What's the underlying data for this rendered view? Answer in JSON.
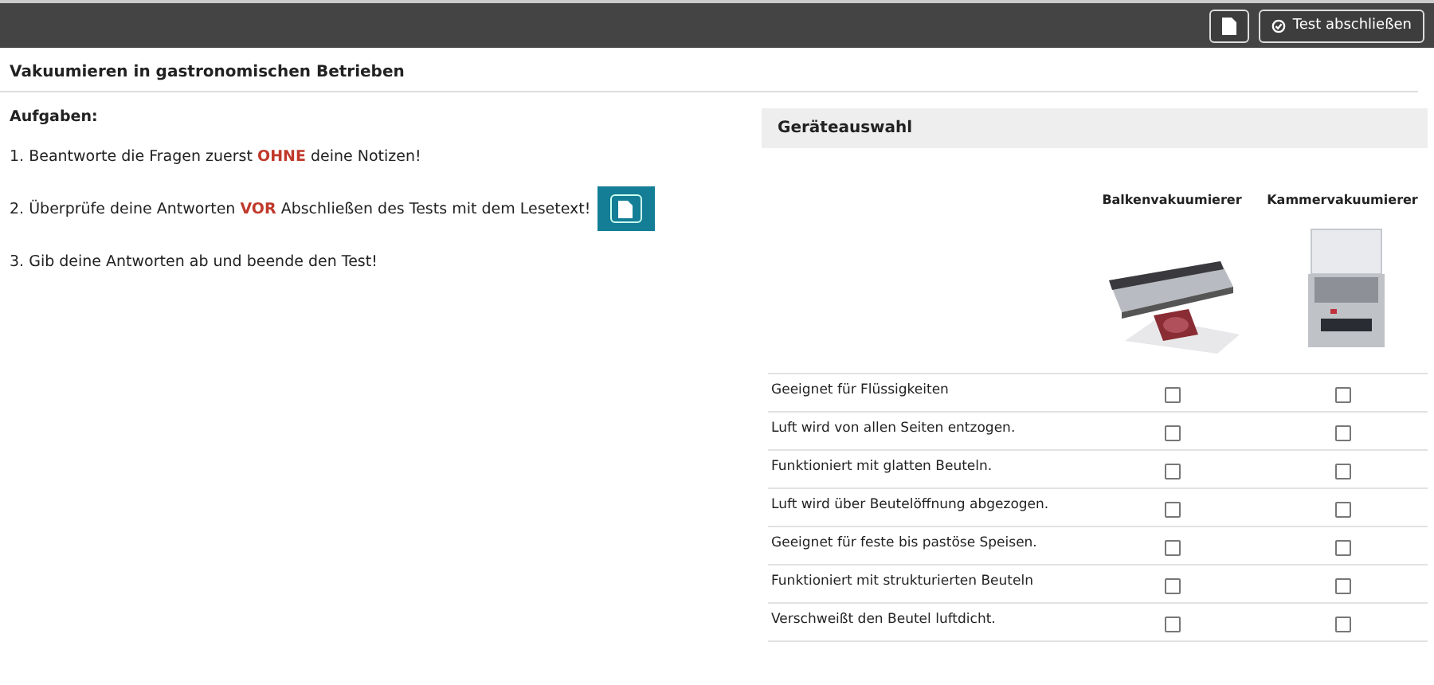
{
  "toolbar": {
    "buttons": [
      {
        "kind": "icon"
      },
      {
        "kind": "text",
        "label": "Test abschließen"
      }
    ]
  },
  "page_title": "Vakuumieren in gastronomischen Betrieben",
  "tasks": {
    "heading": "Aufgaben:",
    "items": [
      {
        "kind": "text",
        "text": "1. Beantworte die Fragen zuerst **OHNE** deine Notizen!"
      },
      {
        "kind": "with_button",
        "text": "2. Überprüfe deine Antworten **VOR** Abschließen des Tests mit dem Lesetext!"
      },
      {
        "kind": "text",
        "text": "3. Gib deine Antworten ab und beende den Test!"
      }
    ]
  },
  "selection": {
    "title": "Geräteauswahl",
    "columns": [
      {
        "name": "Balkenvakuumierer",
        "kind": "picture"
      },
      {
        "name": "Kammervakuumierer",
        "kind": "picture"
      }
    ],
    "rows": [
      {
        "label": "Geeignet für Flüssigkeiten",
        "checked": [
          false,
          false
        ]
      },
      {
        "label": "Luft wird von allen Seiten entzogen.",
        "checked": [
          false,
          false
        ]
      },
      {
        "label": "Funktioniert mit glatten Beuteln.",
        "checked": [
          false,
          false
        ]
      },
      {
        "label": "Luft wird über Beutelöffnung abgezogen.",
        "checked": [
          false,
          false
        ]
      },
      {
        "label": "Geeignet für feste bis pastöse Speisen.",
        "checked": [
          false,
          false
        ]
      },
      {
        "label": "Funktioniert mit strukturierten Beuteln",
        "checked": [
          false,
          false
        ]
      },
      {
        "label": "Verschweißt den Beutel luftdicht.",
        "checked": [
          false,
          false
        ]
      }
    ]
  }
}
